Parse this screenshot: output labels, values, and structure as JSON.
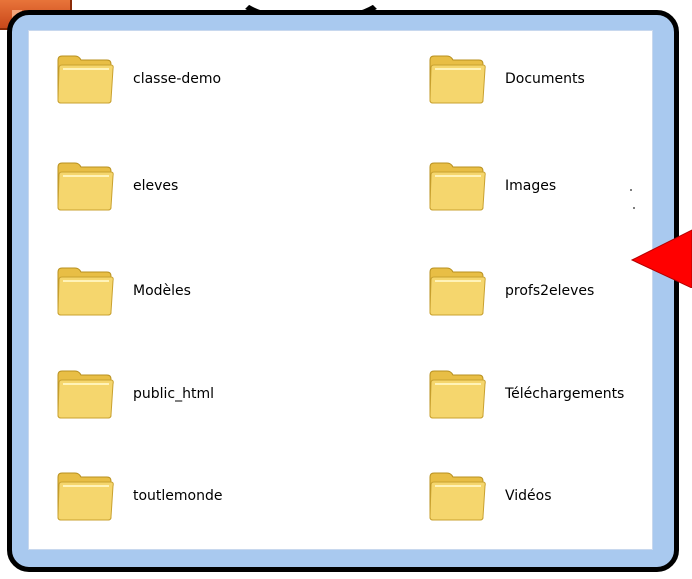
{
  "colors": {
    "frame_fill": "#a9c9ef",
    "frame_border": "#000000",
    "pane": "#ffffff",
    "folder_front": "#f5d66d",
    "folder_back": "#e8be45",
    "arrow": "#ff0000",
    "tab": "#d65a24"
  },
  "folders": [
    {
      "label": "classe-demo"
    },
    {
      "label": "eleves"
    },
    {
      "label": "Modèles"
    },
    {
      "label": "public_html"
    },
    {
      "label": "toutlemonde"
    },
    {
      "label": "Documents"
    },
    {
      "label": "Images"
    },
    {
      "label": "profs2eleves"
    },
    {
      "label": "Téléchargements"
    },
    {
      "label": "Vidéos"
    }
  ]
}
